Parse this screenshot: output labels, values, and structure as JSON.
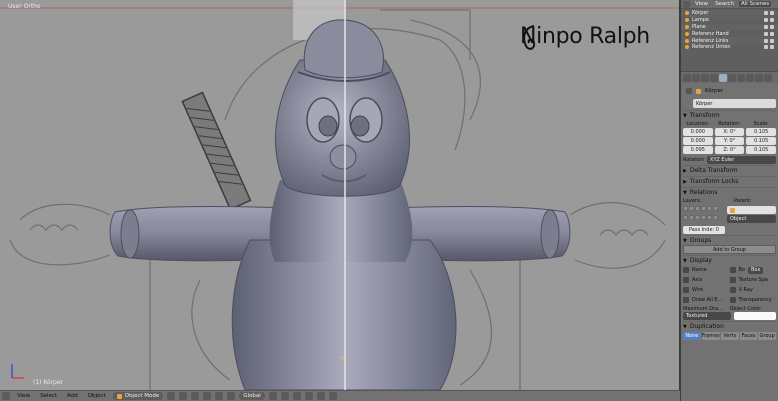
{
  "viewport": {
    "view_label": "User Ortho",
    "object_label": "(1) Körper",
    "logo_text": "Ninpo Ralph"
  },
  "bottom_bar": {
    "items": [
      "View",
      "Select",
      "Add",
      "Object"
    ],
    "mode": "Object Mode",
    "orientation": "Global"
  },
  "outliner": {
    "tabs": [
      "View",
      "Search",
      "All Scenes"
    ],
    "active_tab": "All Scenes",
    "rows": [
      "Körper",
      "Lampe",
      "Plane",
      "Referenz Hand",
      "Referenz Links",
      "Referenz Unten"
    ]
  },
  "properties": {
    "breadcrumb": "Körper",
    "object_name": "Körper",
    "transform": {
      "title": "Transform",
      "location_label": "Location:",
      "rotation_label": "Rotation:",
      "scale_label": "Scale:",
      "location": [
        "0.000",
        "0.000",
        "0.095"
      ],
      "rotation": [
        "X: 0°",
        "Y: 0°",
        "Z: 0°"
      ],
      "scale": [
        "0.105",
        "0.105",
        "0.105"
      ],
      "rotation_mode_label": "Rotation",
      "rotation_mode": "XYZ Euler"
    },
    "delta_transform": "Delta Transform",
    "transform_locks": "Transform Locks",
    "relations": {
      "title": "Relations",
      "layers_label": "Layers:",
      "parent_label": "Parent:",
      "parent_type": "Object",
      "pass_index": "Pass Inde: 0"
    },
    "groups": {
      "title": "Groups",
      "add_button": "Add to Group"
    },
    "display": {
      "title": "Display",
      "checks": [
        [
          "Name",
          "Bo"
        ],
        [
          "Axis",
          "Texture Spa"
        ],
        [
          "Wire",
          "X-Ray"
        ],
        [
          "Draw All E...",
          "Transparency"
        ]
      ],
      "bounds_type": "Box",
      "max_draw_label": "Maximum Dra...",
      "object_color_label": "Object Color:",
      "draw_type": "Textured"
    },
    "duplication": {
      "title": "Duplication",
      "tabs": [
        "None",
        "Frames",
        "Verts",
        "Faces",
        "Group"
      ],
      "active": "None"
    }
  }
}
